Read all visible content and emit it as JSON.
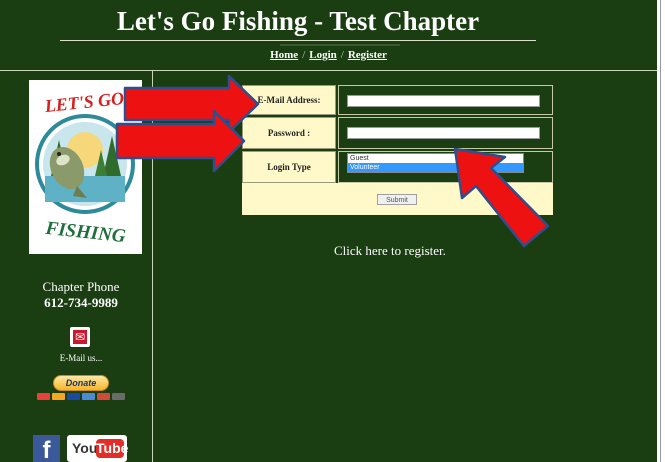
{
  "header": {
    "title": "Let's Go Fishing - Test Chapter",
    "nav": {
      "home": "Home",
      "login": "Login",
      "register": "Register",
      "separator": "/"
    }
  },
  "sidebar": {
    "logo_top": "LET'S GO",
    "logo_bottom": "FISHING",
    "phone_label": "Chapter Phone",
    "phone": "612-734-9989",
    "email_label": "E-Mail us...",
    "donate_label": "Donate",
    "social": {
      "facebook": "f",
      "youtube_you": "You",
      "youtube_tube": "Tube"
    }
  },
  "form": {
    "email_label": "E-Mail Address:",
    "email_value": "",
    "password_label": "Password :",
    "password_value": "",
    "login_type_label": "Login Type",
    "login_type_options": [
      "Guest",
      "Volunteer"
    ],
    "login_type_selected": "Volunteer",
    "submit_label": "Submit"
  },
  "register_link": "Click here to register.",
  "colors": {
    "background": "#1a3d12",
    "label_bg": "#fff8c8",
    "arrow": "#ee1111",
    "arrow_outline": "#2f4f8c",
    "selection": "#3399ff"
  }
}
